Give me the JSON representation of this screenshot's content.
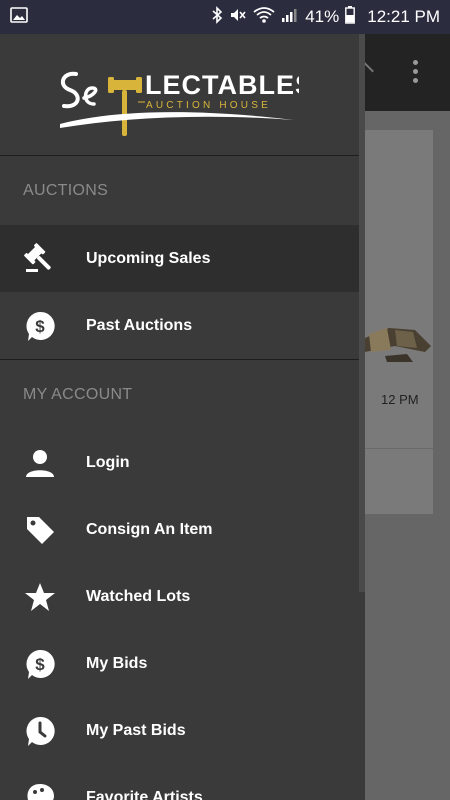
{
  "status_bar": {
    "battery_percent": "41%",
    "time": "12:21 PM"
  },
  "brand": {
    "logo_main": "Se LECTABLES",
    "logo_sub": "AUCTION HOUSE",
    "accent_color": "#d8b53a"
  },
  "drawer": {
    "sections": [
      {
        "label": "AUCTIONS",
        "items": [
          {
            "label": "Upcoming Sales",
            "icon": "gavel-icon",
            "selected": true
          },
          {
            "label": "Past Auctions",
            "icon": "dollar-bubble-icon",
            "selected": false
          }
        ]
      },
      {
        "label": "MY ACCOUNT",
        "items": [
          {
            "label": "Login",
            "icon": "person-icon"
          },
          {
            "label": "Consign An Item",
            "icon": "tag-icon"
          },
          {
            "label": "Watched Lots",
            "icon": "star-icon"
          },
          {
            "label": "My Bids",
            "icon": "dollar-bubble-icon"
          },
          {
            "label": "My Past Bids",
            "icon": "clock-bubble-icon"
          },
          {
            "label": "Favorite Artists",
            "icon": "palette-icon"
          }
        ]
      }
    ]
  },
  "background_app": {
    "visible_time_fragment": "12 PM"
  }
}
